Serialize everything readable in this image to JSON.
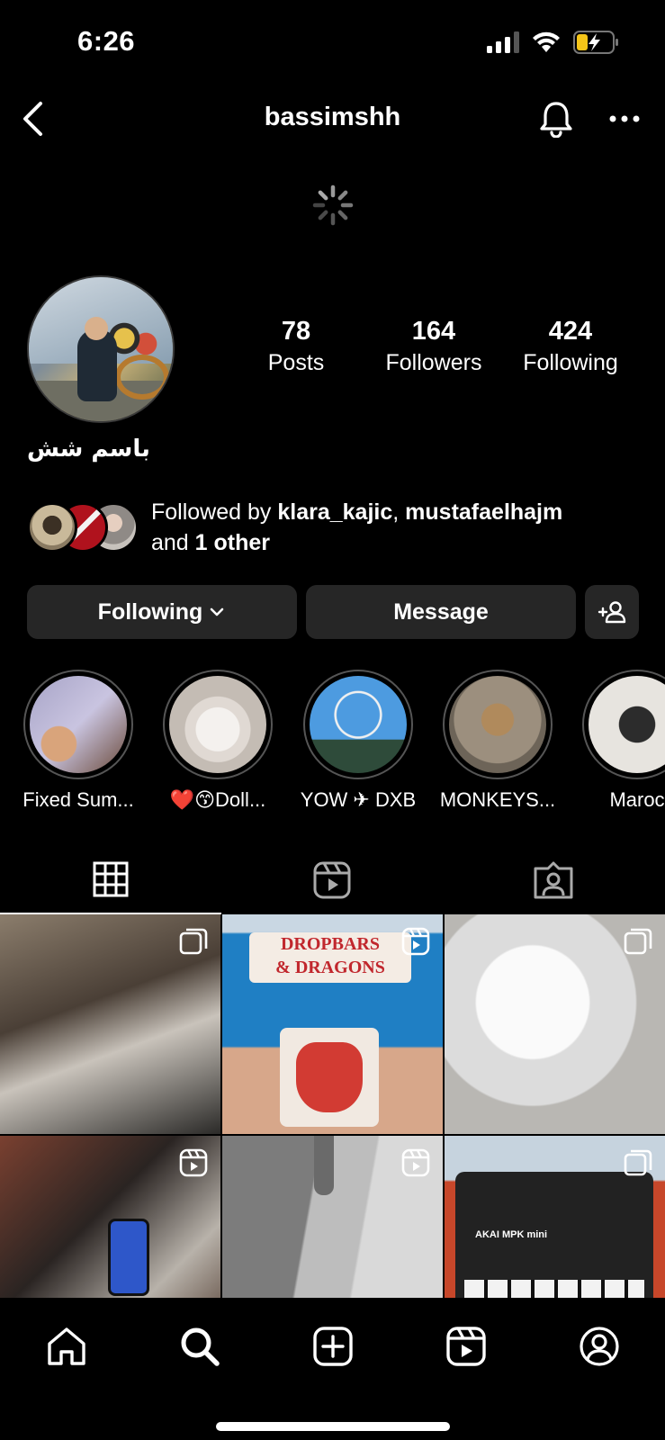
{
  "status_bar": {
    "time": "6:26"
  },
  "header": {
    "username": "bassimshh"
  },
  "profile": {
    "display_name": "باسم شش",
    "stats": [
      {
        "value": "78",
        "label": "Posts"
      },
      {
        "value": "164",
        "label": "Followers"
      },
      {
        "value": "424",
        "label": "Following"
      }
    ],
    "followed_by": {
      "prefix": "Followed by ",
      "user1": "klara_kajic",
      "separator": ", ",
      "user2": "mustafaelhajm",
      "middle": "and ",
      "others": "1 other"
    }
  },
  "actions": {
    "following_label": "Following",
    "message_label": "Message"
  },
  "highlights": [
    {
      "label": "Fixed Sum..."
    },
    {
      "label": "❤️😙Doll..."
    },
    {
      "label": "YOW ✈ DXB"
    },
    {
      "label": "MONKEYS..."
    },
    {
      "label": "Maroc"
    }
  ],
  "grid": {
    "poster_line1": "DROPBARS",
    "poster_line2": "& DRAGONS",
    "keyboard_brand": "AKAI MPK mini"
  },
  "icons": {
    "back": "chevron-left-icon",
    "bell": "bell-icon",
    "more": "more-horizontal-icon",
    "add_user": "add-user-icon",
    "grid_tab": "grid-icon",
    "reels_tab": "reels-icon",
    "tagged_tab": "tagged-icon",
    "home": "home-icon",
    "search": "search-icon",
    "create": "create-icon",
    "profile": "profile-icon"
  },
  "colors": {
    "background": "#000000",
    "button": "#262626",
    "battery_charging": "#f5c518"
  }
}
